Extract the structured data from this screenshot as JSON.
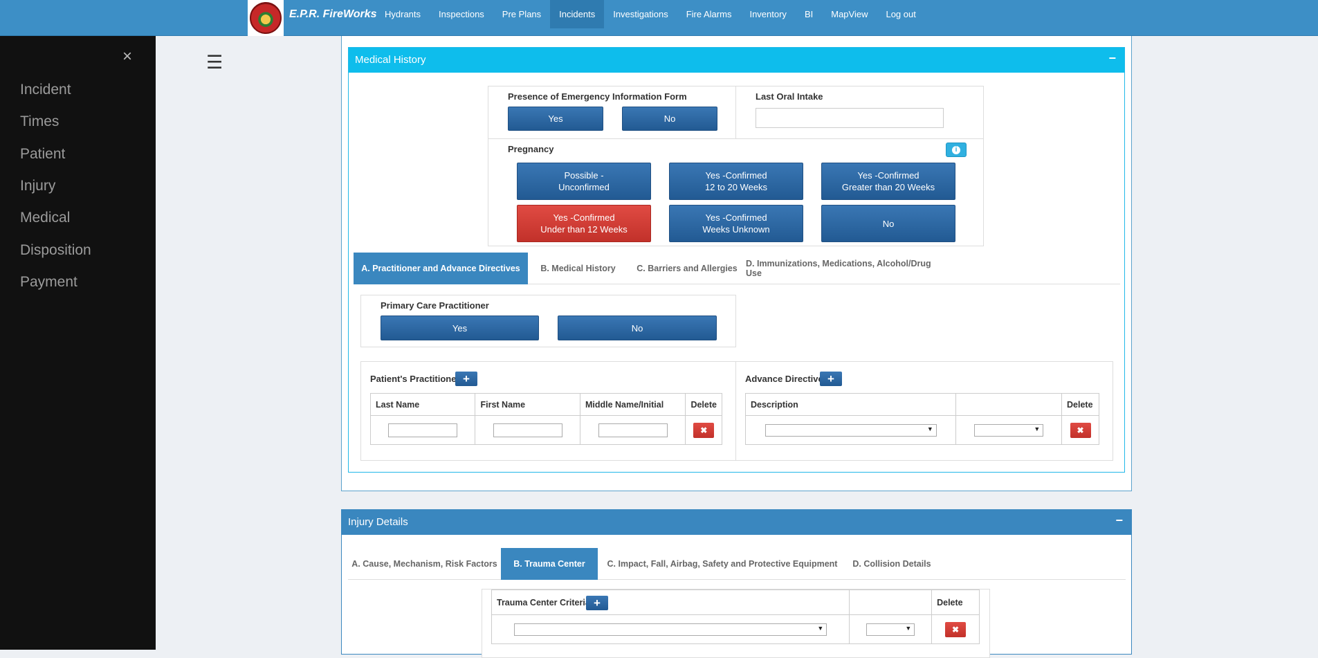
{
  "app": {
    "brand": "E.P.R. FireWorks"
  },
  "nav": [
    "Hydrants",
    "Inspections",
    "Pre Plans",
    "Incidents",
    "Investigations",
    "Fire Alarms",
    "Inventory",
    "BI",
    "MapView",
    "Log out"
  ],
  "sidebar": {
    "close": "×",
    "items": [
      "Incident",
      "Times",
      "Patient",
      "Injury",
      "Medical",
      "Disposition",
      "Payment"
    ]
  },
  "menu_icon": "☰",
  "medical": {
    "title": "Medical History",
    "collapse": "−",
    "emergency_form": {
      "label": "Presence of Emergency Information Form",
      "yes": "Yes",
      "no": "No"
    },
    "last_oral_intake": {
      "label": "Last Oral Intake",
      "value": ""
    },
    "pregnancy": {
      "label": "Pregnancy",
      "info": "i",
      "options": [
        {
          "line1": "Possible -",
          "line2": "Unconfirmed"
        },
        {
          "line1": "Yes -Confirmed",
          "line2": "12 to 20 Weeks"
        },
        {
          "line1": "Yes -Confirmed",
          "line2": "Greater than 20 Weeks"
        },
        {
          "line1": "Yes -Confirmed",
          "line2": "Under than 12 Weeks"
        },
        {
          "line1": "Yes -Confirmed",
          "line2": "Weeks Unknown"
        },
        {
          "line1": "No",
          "line2": ""
        }
      ],
      "selected_color": "#d73a32"
    },
    "tabs": [
      "A. Practitioner and Advance Directives",
      "B. Medical History",
      "C. Barriers and Allergies",
      "D. Immunizations, Medications, Alcohol/Drug Use"
    ],
    "primary_care": {
      "label": "Primary Care Practitioner",
      "yes": "Yes",
      "no": "No"
    },
    "practitioner": {
      "label": "Patient's Practitioner",
      "plus": "+",
      "columns": [
        "Last Name",
        "First Name",
        "Middle Name/Initial",
        "Delete"
      ],
      "delete": "✖"
    },
    "advance": {
      "label": "Advance Directives",
      "plus": "+",
      "columns": [
        "Description",
        "",
        "Delete"
      ],
      "delete": "✖",
      "arrow": "▼"
    }
  },
  "injury": {
    "title": "Injury Details",
    "collapse": "−",
    "tabs": [
      "A. Cause, Mechanism, Risk Factors",
      "B. Trauma Center",
      "C. Impact, Fall, Airbag, Safety and Protective Equipment",
      "D. Collision Details"
    ],
    "trauma": {
      "label": "Trauma Center Criteria",
      "plus": "+",
      "delete_col": "Delete",
      "delete": "✖",
      "arrow": "▼"
    }
  },
  "colors": {
    "nav": "#3d8fc6",
    "panel_head": "#0ebdec",
    "injury_head": "#3a87bf",
    "sidebar": "#111111"
  }
}
